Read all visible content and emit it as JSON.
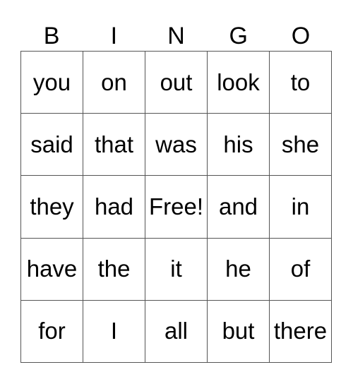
{
  "header": [
    "B",
    "I",
    "N",
    "G",
    "O"
  ],
  "rows": [
    [
      "you",
      "on",
      "out",
      "look",
      "to"
    ],
    [
      "said",
      "that",
      "was",
      "his",
      "she"
    ],
    [
      "they",
      "had",
      "Free!",
      "and",
      "in"
    ],
    [
      "have",
      "the",
      "it",
      "he",
      "of"
    ],
    [
      "for",
      "I",
      "all",
      "but",
      "there"
    ]
  ]
}
